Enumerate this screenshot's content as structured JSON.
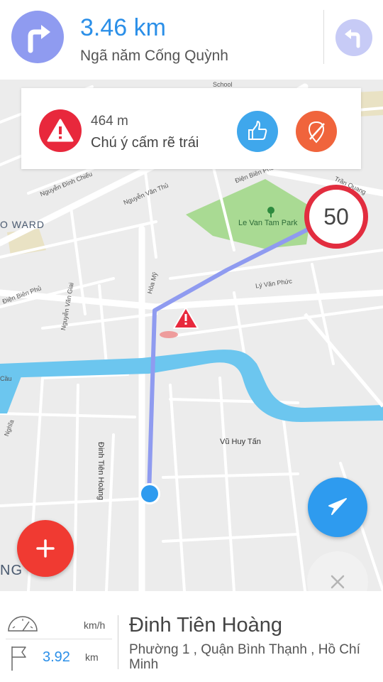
{
  "header": {
    "next_distance": "3.46 km",
    "next_street": "Ngã năm Cống Quỳnh",
    "turn_icon": "turn-right-icon",
    "then_icon": "turn-left-icon"
  },
  "alert": {
    "distance": "464 m",
    "message": "Chú ý cấm rẽ trái",
    "icon": "warning-icon",
    "like_icon": "thumbs-up-icon",
    "dislike_icon": "thumbs-down-icon"
  },
  "speed_limit": "50",
  "map": {
    "labels": {
      "district": "O WARD",
      "park": "Le Van Tam Park",
      "vu_huy_tan": "Vũ Huy Tấn",
      "dinh_tien_hoang": "Đinh Tiên Hoàng",
      "ly_van_phuc": "Lý Văn Phức",
      "dien_bien_phu_1": "Điện Biên Phủ",
      "dien_bien_phu_2": "Điện Biên Phủ",
      "nguyen_van_giai": "Nguyễn Văn Giai",
      "hoa_my": "Hòa Mỹ",
      "nguyen_van_thu": "Nguyễn Văn Thủ",
      "nguyen_dinh_chieu": "Nguyễn Đình Chiểu",
      "tran_quang": "Trần Quang",
      "cau": "Cầu",
      "nghia": "Nghĩa",
      "school": "School",
      "edge_ng": "NG"
    }
  },
  "buttons": {
    "add_icon": "plus-icon",
    "locate_icon": "location-arrow-icon",
    "close_icon": "close-icon"
  },
  "bottom": {
    "speed_unit": "km/h",
    "remaining_distance": "3.92",
    "remaining_unit": "km",
    "current_street": "Đinh Tiên Hoàng",
    "current_area": "Phường 1 , Quận Bình Thạnh , Hồ Chí Minh"
  },
  "colors": {
    "accent_blue": "#2b8fe8",
    "route": "#8f9bf0",
    "alert_red": "#e8283c",
    "river": "#6cc6ef",
    "park": "#a9da93"
  }
}
